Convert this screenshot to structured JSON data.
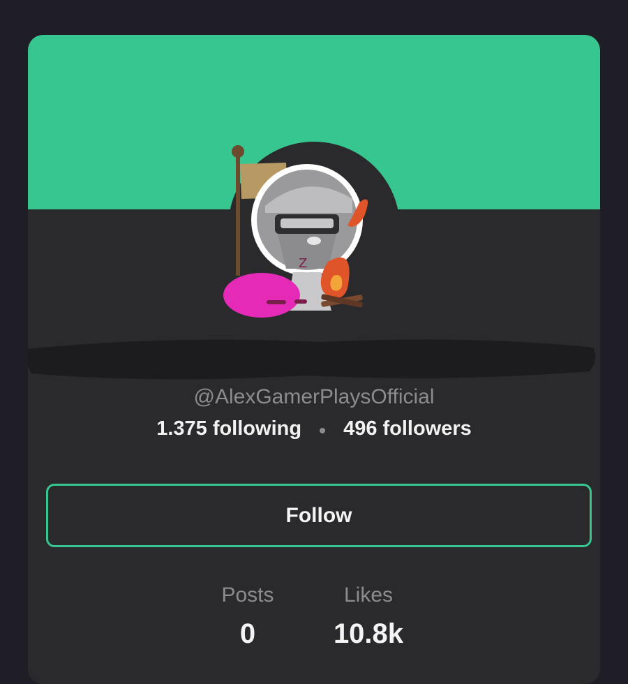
{
  "profile": {
    "username": "@AlexGamerPlaysOfficial",
    "following_count": "1.375",
    "following_label": "following",
    "followers_count": "496",
    "followers_label": "followers"
  },
  "actions": {
    "follow_label": "Follow"
  },
  "metrics": {
    "posts_label": "Posts",
    "posts_value": "0",
    "likes_label": "Likes",
    "likes_value": "10.8k"
  },
  "colors": {
    "accent": "#37c590",
    "background": "#1f1e26",
    "card": "#2a2a2d",
    "muted_text": "#8c8c90"
  },
  "icons": {
    "avatar": "avatar-illustration",
    "separator": "dot-separator"
  }
}
